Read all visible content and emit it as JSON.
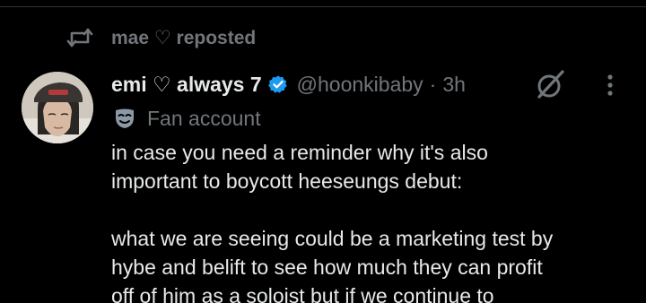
{
  "repost": {
    "text": "mae ♡ reposted",
    "icon": "repost-icon"
  },
  "post": {
    "author": {
      "display_name": "emi ♡ always 7",
      "handle": "@hoonkibaby",
      "verified": true,
      "avatar_icon": "avatar"
    },
    "separator": "·",
    "time": "3h",
    "label": {
      "text": "Fan account",
      "icon": "mask-icon"
    },
    "paragraphs": [
      {
        "lines": [
          "in case you need a reminder why it's also",
          "important to boycott heeseungs debut:"
        ]
      },
      {
        "lines": [
          "what we are seeing could be a marketing test by",
          "hybe and belift to see how much they can profit",
          "off of him as a soloist but if we continue to"
        ]
      }
    ]
  },
  "colors": {
    "background": "#000000",
    "primary_text": "#e7e9ea",
    "secondary_text": "#71767b",
    "verified_badge": "#1d9bf0",
    "divider": "#2f3336"
  }
}
